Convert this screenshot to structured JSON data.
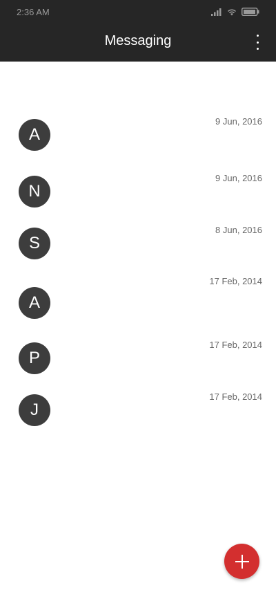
{
  "status_bar": {
    "time": "2:36 AM",
    "icons": [
      "signal-icon",
      "wifi-icon",
      "battery-icon"
    ]
  },
  "app_bar": {
    "title": "Messaging",
    "menu_icon": "overflow-menu-icon"
  },
  "conversations": [
    {
      "initial": "A",
      "date": "9 Jun, 2016"
    },
    {
      "initial": "N",
      "date": "9 Jun, 2016"
    },
    {
      "initial": "S",
      "date": "8 Jun, 2016"
    },
    {
      "initial": "A",
      "date": "17 Feb, 2014"
    },
    {
      "initial": "P",
      "date": "17 Feb, 2014"
    },
    {
      "initial": "J",
      "date": "17 Feb, 2014"
    }
  ],
  "fab": {
    "icon": "plus-icon",
    "color": "#d32f2f"
  },
  "colors": {
    "app_bar": "#262626",
    "avatar": "#3d3d3d",
    "accent": "#d32f2f"
  }
}
